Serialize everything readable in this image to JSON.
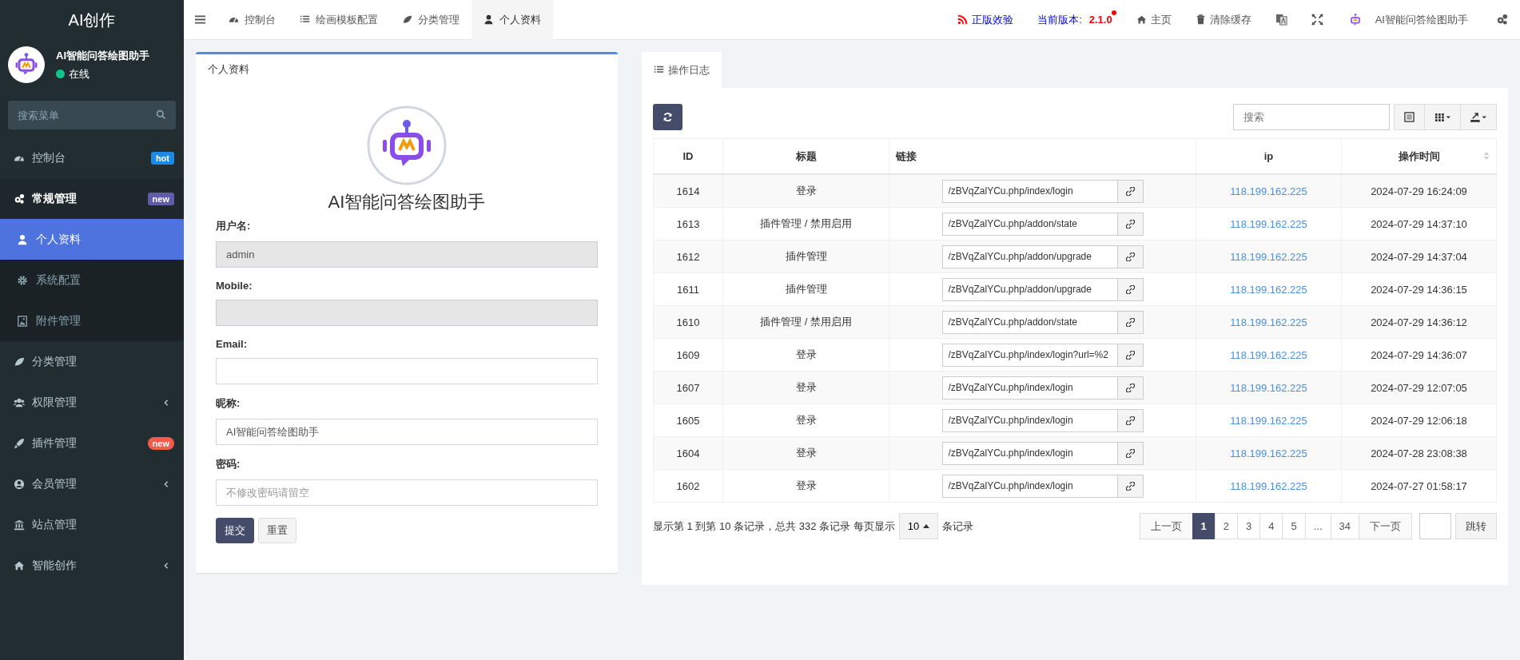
{
  "sidebar": {
    "logo": "AI创作",
    "user": {
      "name": "AI智能问答绘图助手",
      "status": "在线",
      "online": true
    },
    "search": {
      "placeholder": "搜索菜单"
    },
    "items": [
      {
        "label": "控制台",
        "selected": false,
        "badge": {
          "text": "hot",
          "color": "#1e88e5"
        }
      },
      {
        "label": "常规管理",
        "selected": false,
        "expanded": true,
        "badge": {
          "text": "new",
          "color": "#605ca8"
        },
        "children": [
          {
            "label": "个人资料",
            "selected": true
          },
          {
            "label": "系统配置",
            "selected": false
          },
          {
            "label": "附件管理",
            "selected": false
          }
        ]
      },
      {
        "label": "分类管理",
        "selected": false
      },
      {
        "label": "权限管理",
        "selected": false,
        "expanded": false
      },
      {
        "label": "插件管理",
        "selected": false,
        "badge": {
          "text": "new",
          "color": "#f35b4b"
        }
      },
      {
        "label": "会员管理",
        "selected": false,
        "expanded": false
      },
      {
        "label": "站点管理",
        "selected": false
      },
      {
        "label": "智能创作",
        "selected": false,
        "expanded": false
      }
    ]
  },
  "topbar": {
    "tabs": [
      {
        "label": "控制台",
        "selected": false
      },
      {
        "label": "绘画模板配置",
        "selected": false
      },
      {
        "label": "分类管理",
        "selected": false
      },
      {
        "label": "个人资料",
        "selected": true
      }
    ],
    "genuine": "正版效验",
    "version_label": "当前版本:",
    "version": "2.1.0",
    "home": "主页",
    "clear_cache": "清除缓存",
    "user": "AI智能问答绘图助手"
  },
  "profile": {
    "title": "个人资料",
    "name": "AI智能问答绘图助手",
    "fields": [
      {
        "label": "用户名:",
        "value": "admin",
        "disabled": true
      },
      {
        "label": "Mobile:",
        "disabled": true
      },
      {
        "label": "Email:",
        "disabled": false
      },
      {
        "label": "昵称:",
        "value": "AI智能问答绘图助手",
        "disabled": false
      },
      {
        "label": "密码:",
        "placeholder": "不修改密码请留空",
        "disabled": false
      }
    ],
    "submit": "提交",
    "reset": "重置"
  },
  "log": {
    "tab": "操作日志",
    "search": {
      "placeholder": "搜索"
    },
    "columns": [
      "ID",
      "标题",
      "链接",
      "ip",
      "操作时间"
    ],
    "rows": [
      {
        "id": "1614",
        "title": "登录",
        "link": "/zBVqZalYCu.php/index/login",
        "ip": "118.199.162.225",
        "time": "2024-07-29 16:24:09"
      },
      {
        "id": "1613",
        "title": "插件管理 / 禁用启用",
        "link": "/zBVqZalYCu.php/addon/state",
        "ip": "118.199.162.225",
        "time": "2024-07-29 14:37:10"
      },
      {
        "id": "1612",
        "title": "插件管理",
        "link": "/zBVqZalYCu.php/addon/upgrade",
        "ip": "118.199.162.225",
        "time": "2024-07-29 14:37:04"
      },
      {
        "id": "1611",
        "title": "插件管理",
        "link": "/zBVqZalYCu.php/addon/upgrade",
        "ip": "118.199.162.225",
        "time": "2024-07-29 14:36:15"
      },
      {
        "id": "1610",
        "title": "插件管理 / 禁用启用",
        "link": "/zBVqZalYCu.php/addon/state",
        "ip": "118.199.162.225",
        "time": "2024-07-29 14:36:12"
      },
      {
        "id": "1609",
        "title": "登录",
        "link": "/zBVqZalYCu.php/index/login?url=%2",
        "ip": "118.199.162.225",
        "time": "2024-07-29 14:36:07"
      },
      {
        "id": "1607",
        "title": "登录",
        "link": "/zBVqZalYCu.php/index/login",
        "ip": "118.199.162.225",
        "time": "2024-07-29 12:07:05"
      },
      {
        "id": "1605",
        "title": "登录",
        "link": "/zBVqZalYCu.php/index/login",
        "ip": "118.199.162.225",
        "time": "2024-07-29 12:06:18"
      },
      {
        "id": "1604",
        "title": "登录",
        "link": "/zBVqZalYCu.php/index/login",
        "ip": "118.199.162.225",
        "time": "2024-07-28 23:08:38"
      },
      {
        "id": "1602",
        "title": "登录",
        "link": "/zBVqZalYCu.php/index/login",
        "ip": "118.199.162.225",
        "time": "2024-07-27 01:58:17"
      }
    ],
    "summary_before": "显示第 1 到第 10 条记录，总共 332 条记录 每页显示",
    "page_size": "10",
    "summary_after": "条记录",
    "prev": "上一页",
    "next": "下一页",
    "go": "跳转",
    "pages": [
      {
        "label": "1",
        "selected": true
      },
      {
        "label": "2",
        "selected": false
      },
      {
        "label": "3",
        "selected": false
      },
      {
        "label": "4",
        "selected": false
      },
      {
        "label": "5",
        "selected": false
      },
      {
        "label": "...",
        "selected": false
      },
      {
        "label": "34",
        "selected": false
      }
    ]
  }
}
